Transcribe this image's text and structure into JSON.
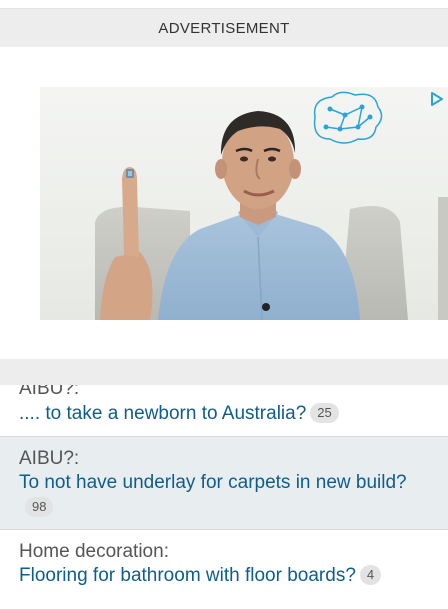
{
  "ad": {
    "label": "ADVERTISEMENT"
  },
  "threads": [
    {
      "category": "AIBU?:",
      "title": ".... to take a newborn to Australia?",
      "replies": "25"
    },
    {
      "category": "AIBU?:",
      "title": "To not have underlay for carpets in new build?",
      "replies": "98"
    },
    {
      "category": "Home decoration:",
      "title": "Flooring for bathroom with floor boards?",
      "replies": "4"
    }
  ],
  "colors": {
    "link": "#0f5d8a",
    "band": "#ededed",
    "alt_row": "#e8edf0",
    "adchoices": "#2aa4d5"
  },
  "icons": [
    "adchoices-icon",
    "brain-network-icon"
  ]
}
